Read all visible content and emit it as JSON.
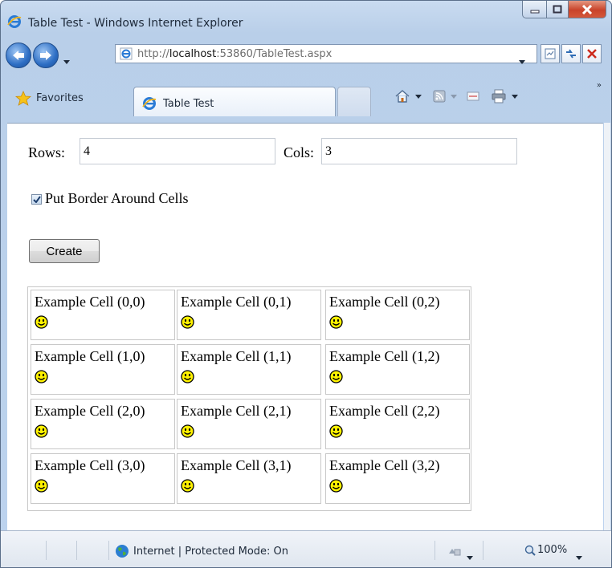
{
  "window": {
    "title": "Table Test - Windows Internet Explorer"
  },
  "address_bar": {
    "url_prefix": "http://",
    "url_host": "localhost",
    "url_rest": ":53860/TableTest.aspx"
  },
  "favorites_label": "Favorites",
  "tab": {
    "label": "Table Test"
  },
  "form": {
    "rows_label": "Rows:",
    "rows_value": "4",
    "cols_label": "Cols:",
    "cols_value": "3",
    "border_checkbox_label": "Put Border Around Cells",
    "border_checked": true,
    "create_label": "Create"
  },
  "table": {
    "rows": [
      [
        "Example Cell (0,0)",
        "Example Cell (0,1)",
        "Example Cell (0,2)"
      ],
      [
        "Example Cell (1,0)",
        "Example Cell (1,1)",
        "Example Cell (1,2)"
      ],
      [
        "Example Cell (2,0)",
        "Example Cell (2,1)",
        "Example Cell (2,2)"
      ],
      [
        "Example Cell (3,0)",
        "Example Cell (3,1)",
        "Example Cell (3,2)"
      ]
    ],
    "cell_icon": "smiley-icon"
  },
  "status_bar": {
    "zone_text": "Internet | Protected Mode: On",
    "zoom": "100%"
  }
}
